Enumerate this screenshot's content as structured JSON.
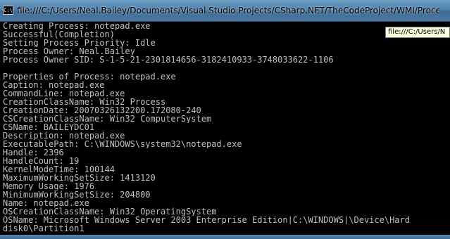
{
  "window": {
    "title": "file:///C:/Users/Neal.Bailey/Documents/Visual Studio Projects/CSharp.NET/TheCodeProject/WMI/Process/W...",
    "icon_label": "C:\\",
    "icon_name": "console-app-icon"
  },
  "tooltip": {
    "text": "file:///C:/Users/N"
  },
  "console": {
    "text_color": "#c0c0c0",
    "background": "#000000",
    "lines": [
      "Creating Process: notepad.exe",
      "Successful(Completion)",
      "Setting Process Priority: Idle",
      "Process Owner: Neal.Bailey",
      "Process Owner SID: S-1-5-21-2301814656-3182410933-3748033622-1106",
      "",
      "Properties of Process: notepad.exe",
      "Caption: notepad.exe",
      "CommandLine: notepad.exe",
      "CreationClassName: Win32_Process",
      "CreationDate: 20070326132200.172080-240",
      "CSCreationClassName: Win32_ComputerSystem",
      "CSName: BAILEYDC01",
      "Description: notepad.exe",
      "ExecutablePath: C:\\WINDOWS\\system32\\notepad.exe",
      "Handle: 2396",
      "HandleCount: 19",
      "KernelModeTime: 100144",
      "MaximumWorkingSetSize: 1413120",
      "Memory Usage: 1976",
      "MinimumWorkingSetSize: 204800",
      "Name: notepad.exe",
      "OSCreationClassName: Win32_OperatingSystem",
      "OSName: Microsoft Windows Server 2003 Enterprise Edition|C:\\WINDOWS|\\Device\\Hard",
      "disk0\\Partition1"
    ]
  }
}
